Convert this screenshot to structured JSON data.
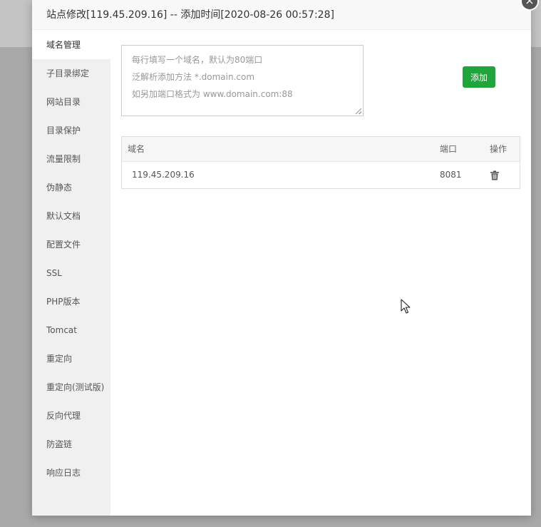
{
  "dialog": {
    "title": "站点修改[119.45.209.16] -- 添加时间[2020-08-26 00:57:28]",
    "close_label": "×"
  },
  "sidebar": {
    "items": [
      {
        "label": "域名管理",
        "active": true
      },
      {
        "label": "子目录绑定"
      },
      {
        "label": "网站目录"
      },
      {
        "label": "目录保护"
      },
      {
        "label": "流量限制"
      },
      {
        "label": "伪静态"
      },
      {
        "label": "默认文档"
      },
      {
        "label": "配置文件"
      },
      {
        "label": "SSL"
      },
      {
        "label": "PHP版本"
      },
      {
        "label": "Tomcat"
      },
      {
        "label": "重定向"
      },
      {
        "label": "重定向(测试版)"
      },
      {
        "label": "反向代理"
      },
      {
        "label": "防盗链"
      },
      {
        "label": "响应日志"
      }
    ]
  },
  "domain_input": {
    "placeholder_lines": [
      "每行填写一个域名，默认为80端口",
      "泛解析添加方法 *.domain.com",
      "如另加端口格式为 www.domain.com:88"
    ],
    "value": ""
  },
  "add_button": {
    "label": "添加"
  },
  "table": {
    "headers": {
      "domain": "域名",
      "port": "端口",
      "operation": "操作"
    },
    "rows": [
      {
        "domain": "119.45.209.16",
        "port": "8081",
        "action_icon": "trash-icon"
      }
    ]
  },
  "colors": {
    "accent": "#20a53a",
    "sidebar_bg": "#f0f0f0",
    "header_bg": "#f8f8f8",
    "overlay": "#a9a9a9"
  }
}
